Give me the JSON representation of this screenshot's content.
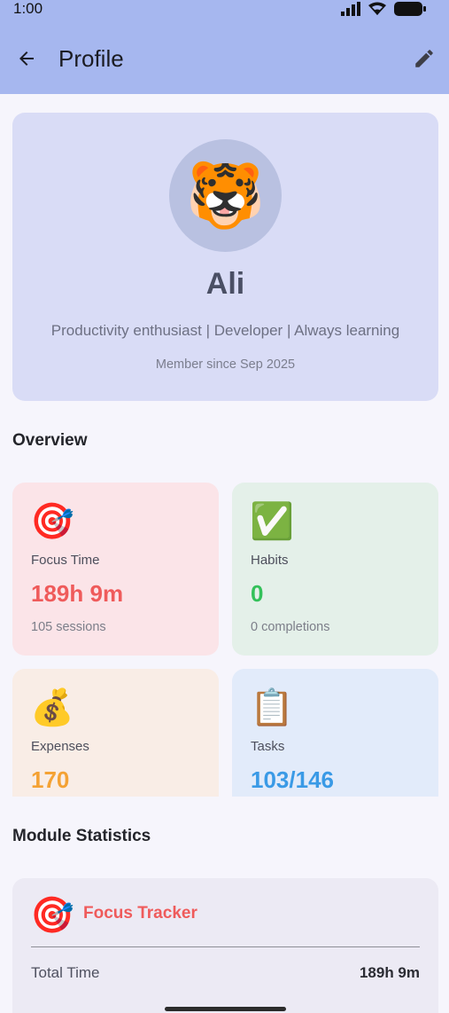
{
  "status_bar": {
    "time": "1:00"
  },
  "toolbar": {
    "title": "Profile"
  },
  "profile": {
    "avatar_emoji": "🐯",
    "name": "Ali",
    "bio": "Productivity enthusiast | Developer | Always learning",
    "member_since": "Member since Sep 2025"
  },
  "overview": {
    "title": "Overview",
    "cards": [
      {
        "emoji": "🎯",
        "label": "Focus Time",
        "value": "189h 9m",
        "sub": "105 sessions",
        "bg": "#fbe4e8",
        "color": "#ef5b5b"
      },
      {
        "emoji": "✅",
        "label": "Habits",
        "value": "0",
        "sub": "0 completions",
        "bg": "#e4f0e9",
        "color": "#33c15a"
      },
      {
        "emoji": "💰",
        "label": "Expenses",
        "value": "170",
        "sub": "",
        "bg": "#f9ede6",
        "color": "#f4a234"
      },
      {
        "emoji": "📋",
        "label": "Tasks",
        "value": "103/146",
        "sub": "",
        "bg": "#e2ebfa",
        "color": "#3a9ae6"
      }
    ]
  },
  "module_statistics": {
    "title": "Module Statistics",
    "modules": [
      {
        "emoji": "🎯",
        "title": "Focus Tracker",
        "rows": [
          {
            "label": "Total Time",
            "value": "189h 9m"
          }
        ]
      }
    ]
  }
}
